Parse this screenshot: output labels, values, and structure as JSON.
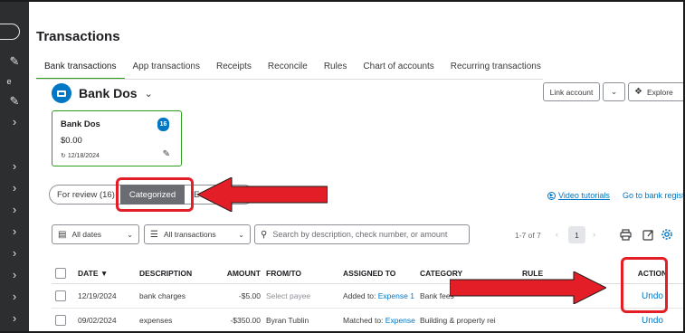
{
  "page": {
    "title": "Transactions"
  },
  "tabs": [
    {
      "label": "Bank transactions",
      "active": true
    },
    {
      "label": "App transactions",
      "active": false
    },
    {
      "label": "Receipts",
      "active": false
    },
    {
      "label": "Reconcile",
      "active": false
    },
    {
      "label": "Rules",
      "active": false
    },
    {
      "label": "Chart of accounts",
      "active": false
    },
    {
      "label": "Recurring transactions",
      "active": false
    }
  ],
  "account": {
    "name": "Bank Dos",
    "link_account_label": "Link account",
    "explore_label": "Explore"
  },
  "card": {
    "name": "Bank Dos",
    "balance": "$0.00",
    "date": "12/18/2024",
    "badge": "16"
  },
  "status_tabs": {
    "review": "For review (16)",
    "categorized": "Categorized",
    "excluded": "E"
  },
  "links": {
    "video_tutorials": "Video tutorials",
    "bank_register": "Go to bank regist"
  },
  "filters": {
    "dates": "All dates",
    "transactions": "All transactions",
    "search_placeholder": "Search by description, check number, or amount"
  },
  "pager": {
    "range": "1-7 of 7",
    "page": "1"
  },
  "table": {
    "headers": {
      "date": "DATE ▼",
      "description": "DESCRIPTION",
      "amount": "AMOUNT",
      "from_to": "FROM/TO",
      "assigned_to": "ASSIGNED TO",
      "category": "CATEGORY",
      "rule": "RULE",
      "action": "ACTION"
    },
    "rows": [
      {
        "date": "12/19/2024",
        "description": "bank charges",
        "amount": "-$5.00",
        "from_to": "Select payee",
        "assigned_prefix": "Added to:",
        "assigned_link": "Expense 1",
        "category": "Bank fees",
        "rule": "",
        "action": "Undo"
      },
      {
        "date": "09/02/2024",
        "description": "expenses",
        "amount": "-$350.00",
        "from_to": "Byran Tublin",
        "assigned_prefix": "Matched to:",
        "assigned_link": "Expense",
        "category": "Building & property rei",
        "rule": "",
        "action": "Undo"
      }
    ]
  },
  "annotations": {
    "highlight_color": "#e41e26"
  },
  "colors": {
    "accent_green": "#2ca01c",
    "link_blue": "#0077c5",
    "nav_dark": "#2d2e30"
  },
  "icons": {
    "account": "bank-card-icon",
    "sync": "sync-icon",
    "edit": "pencil-icon",
    "calendar": "calendar-icon",
    "filter": "filter-sliders-icon",
    "search": "search-icon",
    "print": "print-icon",
    "export": "export-icon",
    "settings": "gear-icon",
    "play": "play-circle-icon"
  }
}
